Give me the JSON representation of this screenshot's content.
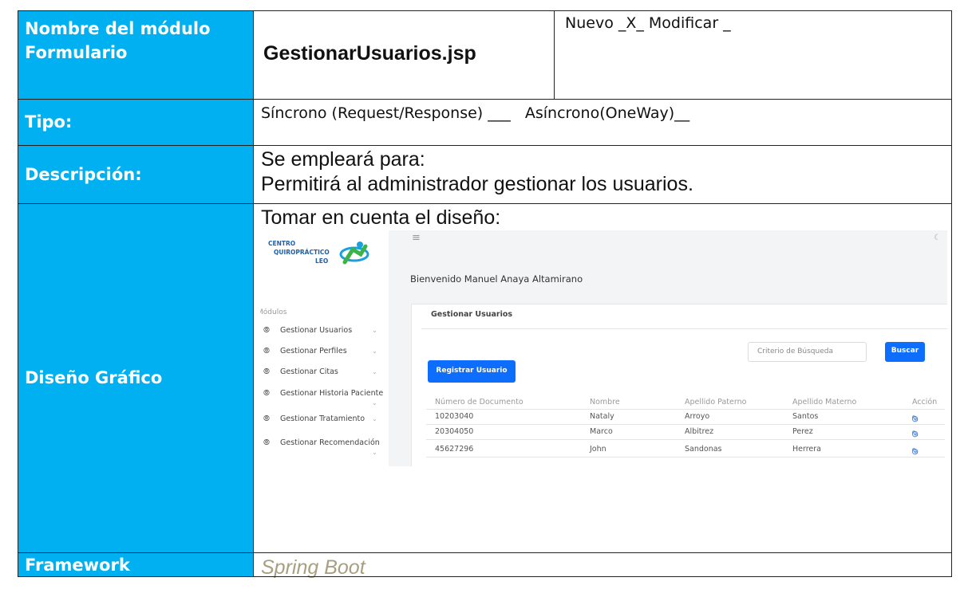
{
  "form": {
    "module_label": "Nombre del módulo Formulario",
    "module_label_line1": "Nombre del módulo",
    "module_label_line2": "Formulario",
    "module_name": "GestionarUsuarios.jsp",
    "status_text": "Nuevo _X_ Modificar _",
    "tipo_label": "Tipo:",
    "tipo_value": "Síncrono (Request/Response) ___   Asíncrono(OneWay)__",
    "descripcion_label": "Descripción:",
    "descripcion_line1": "Se empleará para:",
    "descripcion_line2": "Permitirá al administrador gestionar los usuarios.",
    "diseno_label": "Diseño Gráfico",
    "diseno_intro": "Tomar en cuenta el diseño:",
    "framework_label": "Framework",
    "framework_value": "Spring Boot"
  },
  "mockup": {
    "logo": {
      "line1": "CENTRO",
      "line2": "QUIROPRÁCTICO",
      "line3": "LEO"
    },
    "hamburger_icon": "menu-icon",
    "theme_icon": "moon-icon",
    "welcome": "Bienvenido Manuel Anaya Altamirano",
    "sidebar_heading": "Módulos",
    "sidebar_items": [
      "Gestionar Usuarios",
      "Gestionar Perfiles",
      "Gestionar Citas",
      "Gestionar Historia Paciente",
      "Gestionar Tratamiento",
      "Gestionar Recomendación"
    ],
    "card_title": "Gestionar Usuarios",
    "search_placeholder": "Criterio de Búsqueda",
    "search_button": "Buscar",
    "register_button": "Registrar Usuario",
    "columns": [
      "Número de Documento",
      "Nombre",
      "Apellido Paterno",
      "Apellido Materno",
      "Acción"
    ],
    "rows": [
      [
        "10203040",
        "Nataly",
        "Arroyo",
        "Santos"
      ],
      [
        "20304050",
        "Marco",
        "Albitrez",
        "Perez"
      ],
      [
        "45627296",
        "John",
        "Sandonas",
        "Herrera"
      ]
    ],
    "accent_color": "#0d6efd"
  },
  "colors": {
    "label_bg": "#00b0f0",
    "framework_text": "#a89f80"
  }
}
